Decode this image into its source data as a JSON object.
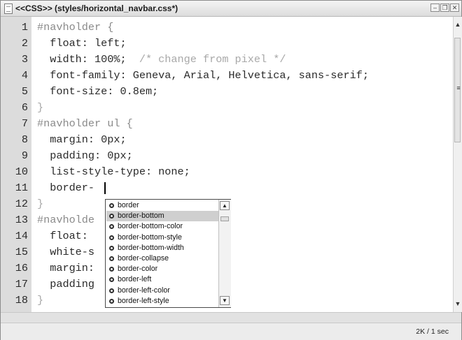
{
  "window": {
    "title": "<<CSS>> (styles/horizontal_navbar.css*)",
    "minimize_label": "–",
    "restore_label": "❐",
    "close_label": "✕"
  },
  "editor": {
    "lines": [
      {
        "number": "1",
        "tokens": [
          {
            "text": "#navholder {",
            "kind": "sel"
          }
        ]
      },
      {
        "number": "2",
        "tokens": [
          {
            "text": "  float: left;",
            "kind": "prop"
          }
        ]
      },
      {
        "number": "3",
        "tokens": [
          {
            "text": "  width: 100%;",
            "kind": "prop"
          },
          {
            "text": "  /* change from pixel */",
            "kind": "cmt"
          }
        ]
      },
      {
        "number": "4",
        "tokens": [
          {
            "text": "  font-family: Geneva, Arial, Helvetica, sans-serif;",
            "kind": "prop"
          }
        ]
      },
      {
        "number": "5",
        "tokens": [
          {
            "text": "  font-size: 0.8em;",
            "kind": "prop"
          }
        ]
      },
      {
        "number": "6",
        "tokens": [
          {
            "text": "}",
            "kind": "brace"
          }
        ]
      },
      {
        "number": "7",
        "tokens": [
          {
            "text": "#navholder ul {",
            "kind": "sel"
          }
        ]
      },
      {
        "number": "8",
        "tokens": [
          {
            "text": "  margin: 0px;",
            "kind": "prop"
          }
        ]
      },
      {
        "number": "9",
        "tokens": [
          {
            "text": "  padding: 0px;",
            "kind": "prop"
          }
        ]
      },
      {
        "number": "10",
        "tokens": [
          {
            "text": "  list-style-type: none;",
            "kind": "prop"
          }
        ]
      },
      {
        "number": "11",
        "tokens": [
          {
            "text": "  border-",
            "kind": "prop"
          }
        ]
      },
      {
        "number": "12",
        "tokens": [
          {
            "text": "}",
            "kind": "brace"
          }
        ]
      },
      {
        "number": "13",
        "tokens": [
          {
            "text": "#navholde",
            "kind": "sel"
          }
        ]
      },
      {
        "number": "14",
        "tokens": [
          {
            "text": "  float:",
            "kind": "prop"
          }
        ]
      },
      {
        "number": "15",
        "tokens": [
          {
            "text": "  white-s",
            "kind": "prop"
          }
        ]
      },
      {
        "number": "16",
        "tokens": [
          {
            "text": "  margin:",
            "kind": "prop"
          }
        ]
      },
      {
        "number": "17",
        "tokens": [
          {
            "text": "  padding",
            "kind": "prop"
          }
        ]
      },
      {
        "number": "18",
        "tokens": [
          {
            "text": "}",
            "kind": "brace"
          }
        ]
      }
    ]
  },
  "code_hints": {
    "selected_index": 1,
    "items": [
      "border",
      "border-bottom",
      "border-bottom-color",
      "border-bottom-style",
      "border-bottom-width",
      "border-collapse",
      "border-color",
      "border-left",
      "border-left-color",
      "border-left-style"
    ],
    "icon": "property-icon",
    "scroll_up": "▲",
    "scroll_down": "▼"
  },
  "scrollbar": {
    "up": "▲",
    "down": "▼",
    "grip": "≡"
  },
  "statusbar": {
    "text": "2K / 1 sec"
  }
}
